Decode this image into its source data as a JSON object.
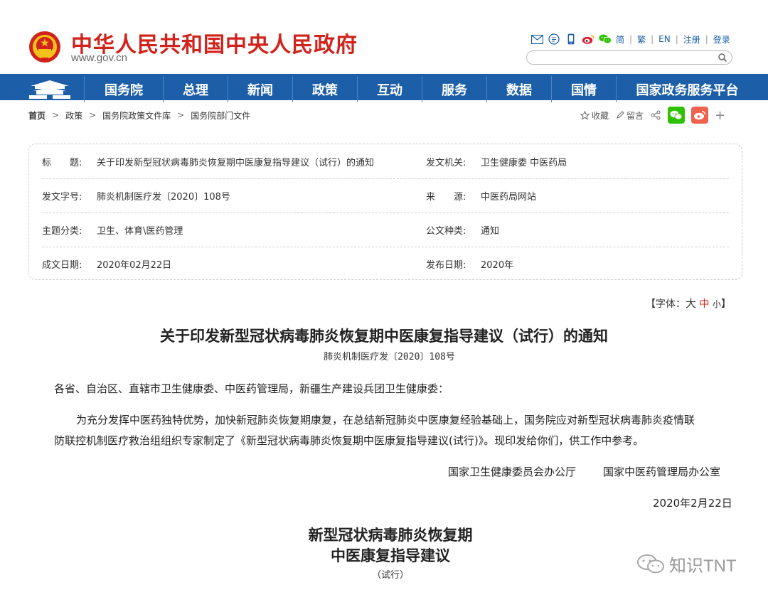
{
  "header": {
    "site_title": "中华人民共和国中央人民政府",
    "site_url": "www.gov.cn",
    "lang_links": [
      "简",
      "繁",
      "EN",
      "注册",
      "登录"
    ],
    "search_placeholder": ""
  },
  "nav": {
    "items": [
      "国务院",
      "总理",
      "新闻",
      "政策",
      "互动",
      "服务",
      "数据",
      "国情",
      "国家政务服务平台"
    ]
  },
  "breadcrumb": [
    "首页",
    "政策",
    "国务院政策文件库",
    "国务院部门文件"
  ],
  "actions": {
    "favorite": "收藏",
    "comment": "留言"
  },
  "info": {
    "title_label": "标　　题:",
    "title_value": "关于印发新型冠状病毒肺炎恢复期中医康复指导建议（试行）的通知",
    "issuer_label": "发文机关:",
    "issuer_value": "卫生健康委 中医药局",
    "docno_label": "发文字号:",
    "docno_value": "肺炎机制医疗发〔2020〕108号",
    "source_label": "来　　源:",
    "source_value": "中医药局网站",
    "topic_label": "主题分类:",
    "topic_value": "卫生、体育\\医药管理",
    "type_label": "公文种类:",
    "type_value": "通知",
    "written_label": "成文日期:",
    "written_value": "2020年02月22日",
    "published_label": "发布日期:",
    "published_value": "2020年"
  },
  "fontsize": {
    "prefix": "【字体：",
    "big": "大",
    "mid": "中",
    "small": "小",
    "suffix": "】"
  },
  "article": {
    "title": "关于印发新型冠状病毒肺炎恢复期中医康复指导建议（试行）的通知",
    "docno": "肺炎机制医疗发〔2020〕108号",
    "greeting": "各省、自治区、直辖市卫生健康委、中医药管理局，新疆生产建设兵团卫生健康委：",
    "body_line1": "为充分发挥中医药独特优势，加快新冠肺炎恢复期康复，在总结新冠肺炎中医康复经验基础上，国务院应对新型冠状病毒肺炎疫情联",
    "body_line2": "防联控机制医疗救治组组织专家制定了《新型冠状病毒肺炎恢复期中医康复指导建议(试行)》。现印发给你们，供工作中参考。",
    "signer1": "国家卫生健康委员会办公厅",
    "signer2": "国家中医药管理局办公室",
    "date": "2020年2月22日",
    "sub_title1": "新型冠状病毒肺炎恢复期",
    "sub_title2": "中医康复指导建议",
    "sub_note": "（试行）"
  },
  "watermark": {
    "text": "知识TNT"
  },
  "colors": {
    "brand_red": "#d0231b",
    "nav_blue": "#1c5fa8",
    "link_blue": "#1a5fa6",
    "wechat_green": "#2dc100",
    "weibo_red": "#f0624d"
  }
}
